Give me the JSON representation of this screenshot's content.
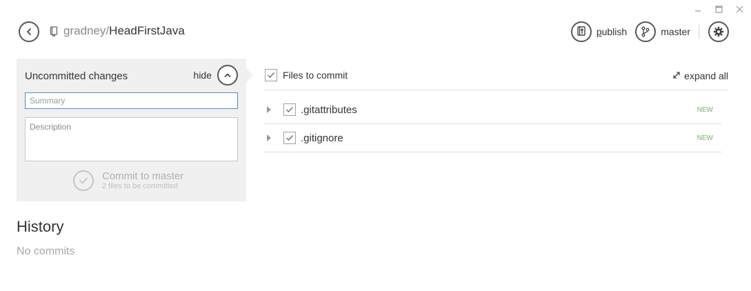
{
  "window": {
    "controls": [
      {
        "name": "minimize-icon"
      },
      {
        "name": "maximize-icon"
      },
      {
        "name": "close-icon"
      }
    ]
  },
  "header": {
    "repo_owner": "gradney",
    "repo_separator": "/",
    "repo_name": "HeadFirstJava"
  },
  "toolbar": {
    "publish_label_underlined": "p",
    "publish_label_rest": "ublish",
    "branch_label": "master"
  },
  "commit_panel": {
    "title": "Uncommitted changes",
    "hide_label": "hide",
    "summary_placeholder": "Summary",
    "description_placeholder": "Description",
    "commit_label": "Commit to master",
    "commit_sublabel": "2 files to be committed"
  },
  "history": {
    "title": "History",
    "empty_text": "No commits"
  },
  "files": {
    "header_label": "Files to commit",
    "expand_label": "expand all",
    "items": [
      {
        "name": ".gitattributes",
        "status": "NEW",
        "checked": true
      },
      {
        "name": ".gitignore",
        "status": "NEW",
        "checked": true
      }
    ]
  },
  "colors": {
    "accent_focus": "#4a90d9",
    "status_new": "#6dbb5a",
    "panel_bg": "#f0f0f0"
  }
}
